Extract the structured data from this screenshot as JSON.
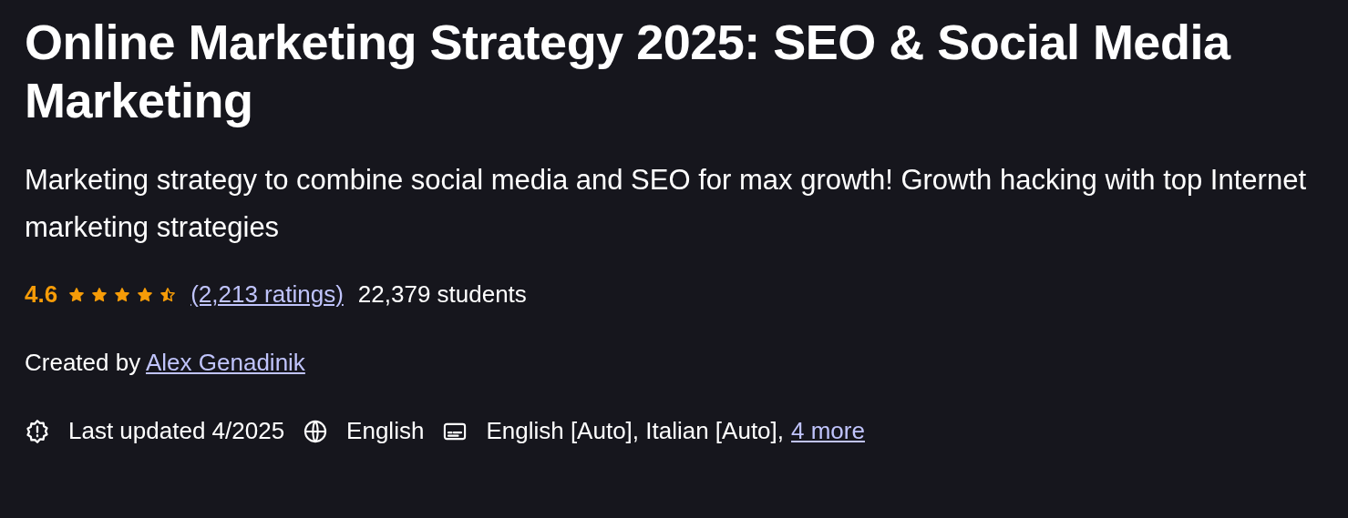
{
  "title": "Online Marketing Strategy 2025: SEO & Social Media Marketing",
  "subtitle": "Marketing strategy to combine social media and SEO for max growth! Growth hacking with top Internet marketing strategies",
  "rating": {
    "value": "4.6",
    "stars": 4.5,
    "ratings_link": "(2,213 ratings)",
    "students": "22,379 students"
  },
  "created_by": {
    "label": "Created by",
    "author": "Alex Genadinik"
  },
  "meta": {
    "last_updated": "Last updated 4/2025",
    "language": "English",
    "captions": "English [Auto], Italian [Auto],",
    "captions_more": "4 more"
  }
}
